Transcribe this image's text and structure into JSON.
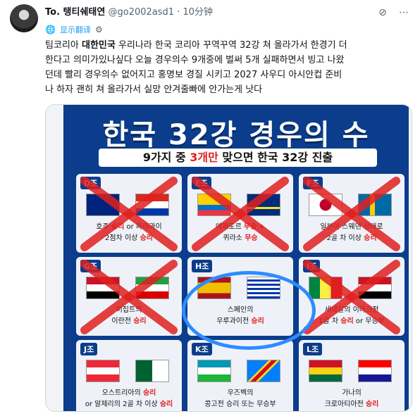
{
  "user": {
    "name": "To. 탱티쉐태연",
    "handle": "@go2002asd1",
    "time": "10分钟"
  },
  "header_icons": {
    "grok": "grok-icon",
    "more": "more-options-icon"
  },
  "translate": {
    "label": "显示翻译"
  },
  "tweet": {
    "line1a": "팀코리아 ",
    "line1b": "대한민국",
    "line1c": " 우리나라 한국 코리아 꾸역꾸역 32강 쳐 올라가서 한경기 더",
    "line2": "한다고 의미가있나싶다 오늘 경우의수 9개중에 벌써 5개 실패하면서 빙고 나왔",
    "line3": "던데 빨리 경우의수 없어지고 홍명보 경질 시키고 2027 사우디 아시안컵 준비",
    "line4": "나 하자 괜히 쳐 올라가서 실망 안겨줄빠에 안가는게 낫다"
  },
  "poster": {
    "title": "한국 32강 경우의 수",
    "banner_a": "9가지 중 ",
    "banner_b": "3개만",
    "banner_c": " 맞으면 한국 32강 진출",
    "cells": [
      {
        "group": "D조",
        "t1": "호주 ",
        "t1r": "승리",
        "t1b": " or 파라과이",
        "t2": "2점차 이상 ",
        "t2r": "승리",
        "crossed": true
      },
      {
        "group": "E조",
        "t1": "에콰도르 ",
        "t1r": "무승",
        "t1b": " +",
        "t2": "퀴라소 ",
        "t2r": "무승",
        "crossed": true
      },
      {
        "group": "F조",
        "t1": "일본이 스웨덴 상대로",
        "t1r": "",
        "t1b": "",
        "t2": "2골 차 이상 ",
        "t2r": "승리",
        "crossed": true
      },
      {
        "group": "G조",
        "t1": "이집트의",
        "t1r": "",
        "t1b": "",
        "t2": "이란전 ",
        "t2r": "승리",
        "crossed": true
      },
      {
        "group": "H조",
        "t1": "스페인의",
        "t1r": "",
        "t1b": "",
        "t2": "우루과이전 ",
        "t2r": "승리",
        "crossed": false
      },
      {
        "group": "I조",
        "t1": "세네갈의 이라크전",
        "t1r": "",
        "t1b": "",
        "t2": "1골 차 ",
        "t2r": "승리",
        "t2b": " or 무승부",
        "crossed": true
      },
      {
        "group": "J조",
        "t1": "오스트리아의 ",
        "t1r": "승리",
        "t1b": "",
        "t2": "or 알제리의 2골 차 이상 ",
        "t2r": "승리",
        "crossed": false
      },
      {
        "group": "K조",
        "t1": "우즈벡의",
        "t1r": "",
        "t1b": "",
        "t2": "콩고전 승리 또는 무승부",
        "t2r": "",
        "crossed": false
      },
      {
        "group": "L조",
        "t1": "가나의",
        "t1r": "",
        "t1b": "",
        "t2": "크로아티아전 ",
        "t2r": "승리",
        "crossed": false
      }
    ]
  },
  "colors": {
    "accent": "#1d9bf0",
    "poster_bg": "#0b3d8c",
    "highlight": "#e02020",
    "circle": "#2d8cff"
  }
}
